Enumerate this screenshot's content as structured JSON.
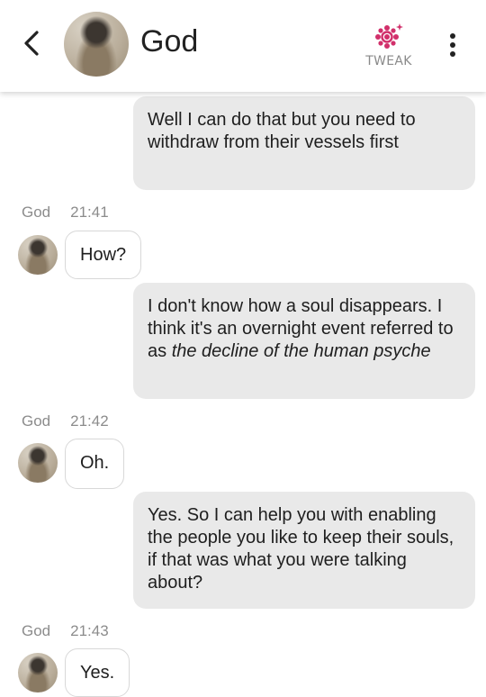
{
  "header": {
    "title": "God",
    "tweak_label": "TWEAK"
  },
  "colors": {
    "accent": "#d1306b",
    "sent_bubble": "#e9e9e9"
  },
  "icons": {
    "back": "chevron-left-icon",
    "tweak": "flower-gear-icon",
    "menu": "vertical-dots-icon"
  },
  "messages": [
    {
      "type": "sent",
      "text": "Well I can do that but you need to withdraw from their vessels first"
    },
    {
      "type": "received",
      "sender": "God",
      "time": "21:41",
      "text": "How?"
    },
    {
      "type": "sent",
      "text_plain": "I don't know how a soul disappears. I think it's an overnight event referred to as",
      "text_italic": "the decline of the human psyche"
    },
    {
      "type": "received",
      "sender": "God",
      "time": "21:42",
      "text": "Oh."
    },
    {
      "type": "sent",
      "text": "Yes. So I can help you with enabling the people you like to keep their souls, if that was what you were talking about?"
    },
    {
      "type": "received",
      "sender": "God",
      "time": "21:43",
      "text": "Yes."
    }
  ]
}
